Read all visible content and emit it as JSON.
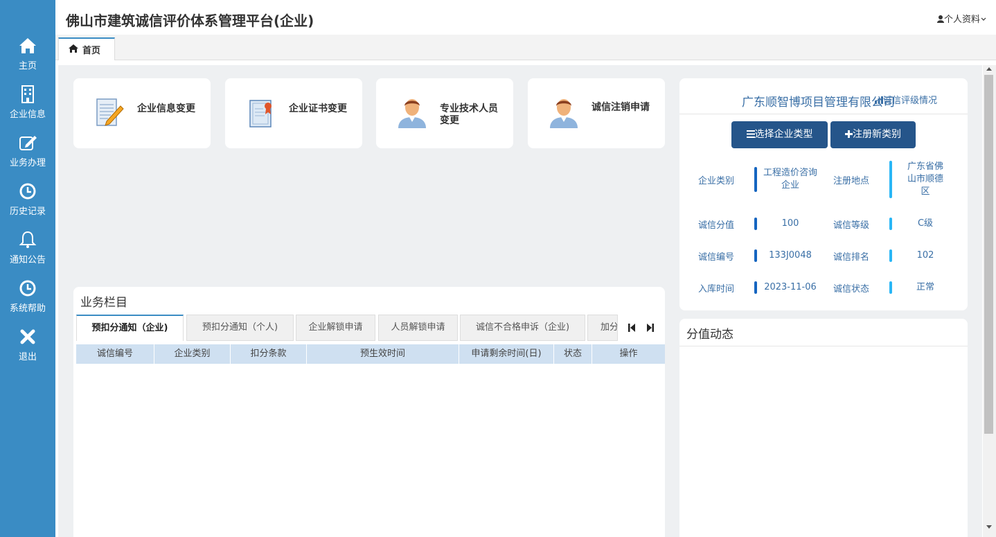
{
  "header": {
    "title": "佛山市建筑诚信评价体系管理平台(企业)",
    "profile": "个人资料"
  },
  "sidebar": {
    "items": [
      {
        "label": "主页",
        "icon": "home-icon"
      },
      {
        "label": "企业信息",
        "icon": "building-icon"
      },
      {
        "label": "业务办理",
        "icon": "edit-icon"
      },
      {
        "label": "历史记录",
        "icon": "clock-icon"
      },
      {
        "label": "通知公告",
        "icon": "bell-icon"
      },
      {
        "label": "系统帮助",
        "icon": "clock-icon"
      },
      {
        "label": "退出",
        "icon": "close-icon"
      }
    ]
  },
  "tabs": {
    "home": "首页"
  },
  "cards": [
    {
      "label": "企业信息变更",
      "icon": "document-edit-icon"
    },
    {
      "label": "企业证书变更",
      "icon": "certificate-icon"
    },
    {
      "label": "专业技术人员变更",
      "icon": "person-icon"
    },
    {
      "label": "诚信注销申请",
      "icon": "person-icon"
    }
  ],
  "business": {
    "title": "业务栏目",
    "tabs": [
      "预扣分通知（企业)",
      "预扣分通知（个人)",
      "企业解锁申请",
      "人员解锁申请",
      "诚信不合格申诉（企业)",
      "加分"
    ],
    "columns": [
      "诚信编号",
      "企业类别",
      "扣分条款",
      "预生效时间",
      "申请剩余时间(日)",
      "状态",
      "操作"
    ]
  },
  "company": {
    "name": "广东顺智博项目管理有限公司",
    "status_link": "诚信评级情况",
    "buttons": {
      "select_type": "选择企业类型",
      "register": "注册新类别"
    },
    "fields": {
      "type_label": "企业类别",
      "type_value": "工程造价咨询企业",
      "location_label": "注册地点",
      "location_value": "广东省佛山市顺德区",
      "score_label": "诚信分值",
      "score_value": "100",
      "grade_label": "诚信等级",
      "grade_value": "C级",
      "code_label": "诚信编号",
      "code_value": "133J0048",
      "rank_label": "诚信排名",
      "rank_value": "102",
      "date_label": "入库时间",
      "date_value": "2023-11-06",
      "state_label": "诚信状态",
      "state_value": "正常"
    }
  },
  "dynamics": {
    "title": "分值动态"
  },
  "colors": {
    "sidebar": "#3a8cc4",
    "primary_button": "#25558a",
    "bar_dark": "#1565c0",
    "bar_light": "#29b6f6"
  }
}
